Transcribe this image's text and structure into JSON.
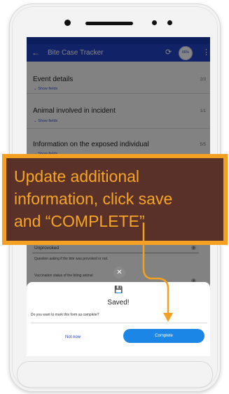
{
  "app": {
    "title": "Bite Case Tracker",
    "progress": "66%",
    "back_icon": "arrow-left-icon",
    "sync_icon": "sync-icon",
    "more_icon": "more-vert-icon"
  },
  "sections": [
    {
      "title": "Event details",
      "count": "2/3",
      "show_label": "Show fields"
    },
    {
      "title": "Animal involved in incident",
      "count": "1/1",
      "show_label": "Show fields"
    },
    {
      "title": "Information on the exposed individual",
      "count": "5/5",
      "show_label": "Show fields"
    }
  ],
  "fields": {
    "provoked_value": "Unprovoked",
    "provoked_note": "Question asking if the bite was provoked or not.",
    "vaccination_label": "Vaccination status of the biting animal"
  },
  "dialog": {
    "title": "Saved!",
    "question": "Do you want to mark this form as complete?",
    "not_now": "Not now",
    "complete": "Complete",
    "save_icon": "save-icon",
    "close_icon": "close-icon"
  },
  "callout": {
    "line1": "Update additional",
    "line2": "information, click save",
    "line3": "and “COMPLETE”"
  },
  "colors": {
    "appbar": "#2141c4",
    "complete_button": "#1c86e6",
    "callout_bg": "#593128",
    "callout_accent": "#f4a023"
  }
}
